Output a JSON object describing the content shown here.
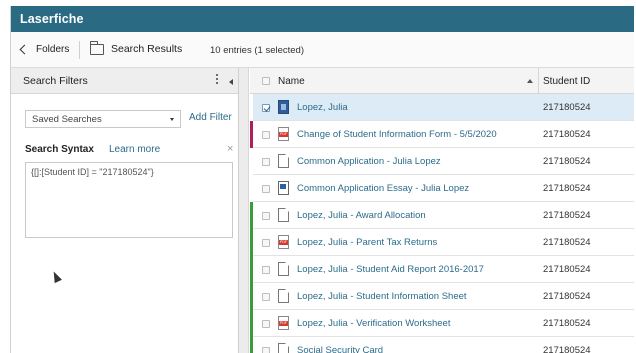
{
  "app": {
    "title": "Laserfiche"
  },
  "breadcrumb": {
    "back_label": "Folders",
    "current_label": "Search Results",
    "entries_text": "10 entries (1 selected)"
  },
  "filters": {
    "title": "Search Filters",
    "saved_searches": "Saved Searches",
    "add_filter": "Add Filter",
    "syntax_label": "Search Syntax",
    "learn_more": "Learn more",
    "close": "×",
    "syntax_value": "{[]:[Student ID] = \"217180524\"}"
  },
  "table": {
    "col_name": "Name",
    "col_student_id": "Student ID",
    "rows": [
      {
        "name": "Lopez, Julia",
        "student_id": "217180524",
        "icon": "blue-document-icon",
        "stripe": "#ffffff",
        "selected": true
      },
      {
        "name": "Change of Student Information Form - 5/5/2020",
        "student_id": "217180524",
        "icon": "pdf-icon",
        "stripe": "#b01e59",
        "selected": false
      },
      {
        "name": "Common Application - Julia Lopez",
        "student_id": "217180524",
        "icon": "document-icon",
        "stripe": "#ffffff",
        "selected": false
      },
      {
        "name": "Common Application Essay - Julia Lopez",
        "student_id": "217180524",
        "icon": "word-document-icon",
        "stripe": "#ffffff",
        "selected": false
      },
      {
        "name": "Lopez, Julia - Award Allocation",
        "student_id": "217180524",
        "icon": "document-icon",
        "stripe": "#3a9b3a",
        "selected": false
      },
      {
        "name": "Lopez, Julia - Parent Tax Returns",
        "student_id": "217180524",
        "icon": "pdf-icon",
        "stripe": "#3a9b3a",
        "selected": false
      },
      {
        "name": "Lopez, Julia - Student Aid Report 2016-2017",
        "student_id": "217180524",
        "icon": "document-icon",
        "stripe": "#3a9b3a",
        "selected": false
      },
      {
        "name": "Lopez, Julia - Student Information Sheet",
        "student_id": "217180524",
        "icon": "document-icon",
        "stripe": "#3a9b3a",
        "selected": false
      },
      {
        "name": "Lopez, Julia - Verification Worksheet",
        "student_id": "217180524",
        "icon": "pdf-icon",
        "stripe": "#3a9b3a",
        "selected": false
      },
      {
        "name": "Social Security Card",
        "student_id": "217180524",
        "icon": "document-icon",
        "stripe": "#3a9b3a",
        "selected": false
      }
    ]
  },
  "colors": {
    "titlebar": "#2a6b83",
    "link": "#2b6c8a",
    "selected_row": "#dcebf6"
  }
}
